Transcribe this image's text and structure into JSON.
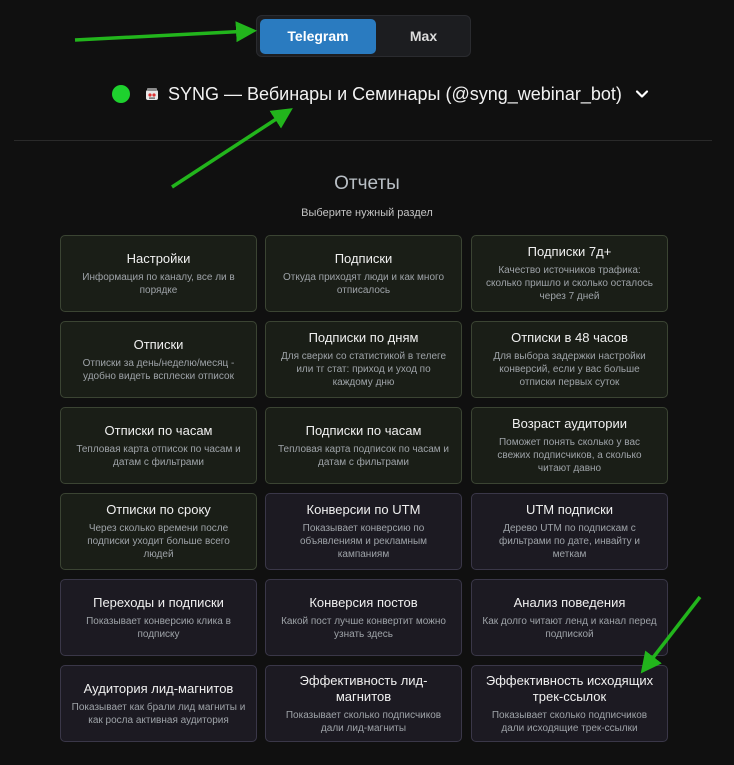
{
  "platform_toggle": {
    "options": [
      "Telegram",
      "Max"
    ],
    "selected": "Telegram"
  },
  "bot": {
    "status_color": "#1ed12e",
    "avatar_icon": "robot-emoji",
    "name": "SYNG — Вебинары и Семинары (@syng_webinar_bot)"
  },
  "section": {
    "title": "Отчеты",
    "subtitle": "Выберите нужный раздел"
  },
  "cards": [
    {
      "title": "Настройки",
      "desc": "Информация по каналу, все ли в порядке"
    },
    {
      "title": "Подписки",
      "desc": "Откуда приходят люди и как много отписалось"
    },
    {
      "title": "Подписки 7д+",
      "desc": "Качество источников трафика: сколько пришло и сколько осталось через 7 дней"
    },
    {
      "title": "Отписки",
      "desc": "Отписки за день/неделю/месяц - удобно видеть всплески отписок"
    },
    {
      "title": "Подписки по дням",
      "desc": "Для сверки со статистикой в телеге или тг стат: приход и уход по каждому дню"
    },
    {
      "title": "Отписки в 48 часов",
      "desc": "Для выбора задержки настройки конверсий, если у вас больше отписки первых суток"
    },
    {
      "title": "Отписки по часам",
      "desc": "Тепловая карта отписок по часам и датам с фильтрами"
    },
    {
      "title": "Подписки по часам",
      "desc": "Тепловая карта подписок по часам и датам с фильтрами"
    },
    {
      "title": "Возраст аудитории",
      "desc": "Поможет понять сколько у вас свежих подписчиков, а сколько читают давно"
    },
    {
      "title": "Отписки по сроку",
      "desc": "Через сколько времени после подписки уходит больше всего людей"
    },
    {
      "title": "Конверсии по UTM",
      "desc": "Показывает конверсию по объявлениям и рекламным кампаниям"
    },
    {
      "title": "UTM подписки",
      "desc": "Дерево UTM по подпискам с фильтрами по дате, инвайту и меткам"
    },
    {
      "title": "Переходы и подписки",
      "desc": "Показывает конверсию клика в подписку"
    },
    {
      "title": "Конверсия постов",
      "desc": "Какой пост лучше конвертит можно узнать здесь"
    },
    {
      "title": "Анализ поведения",
      "desc": "Как долго читают ленд и канал перед подпиской"
    },
    {
      "title": "Аудитория лид-магнитов",
      "desc": "Показывает как брали лид магниты и как росла активная аудитория"
    },
    {
      "title": "Эффективность лид-магнитов",
      "desc": "Показывает сколько подписчиков дали лид-магниты"
    },
    {
      "title": "Эффективность исходящих трек-ссылок",
      "desc": "Показывает сколько подписчиков дали исходящие трек-ссылки"
    }
  ],
  "colors": {
    "accent": "#2a7bc0",
    "arrow": "#22b51c",
    "card_green": "#1a1e17",
    "card_purple": "#1c1a22"
  }
}
